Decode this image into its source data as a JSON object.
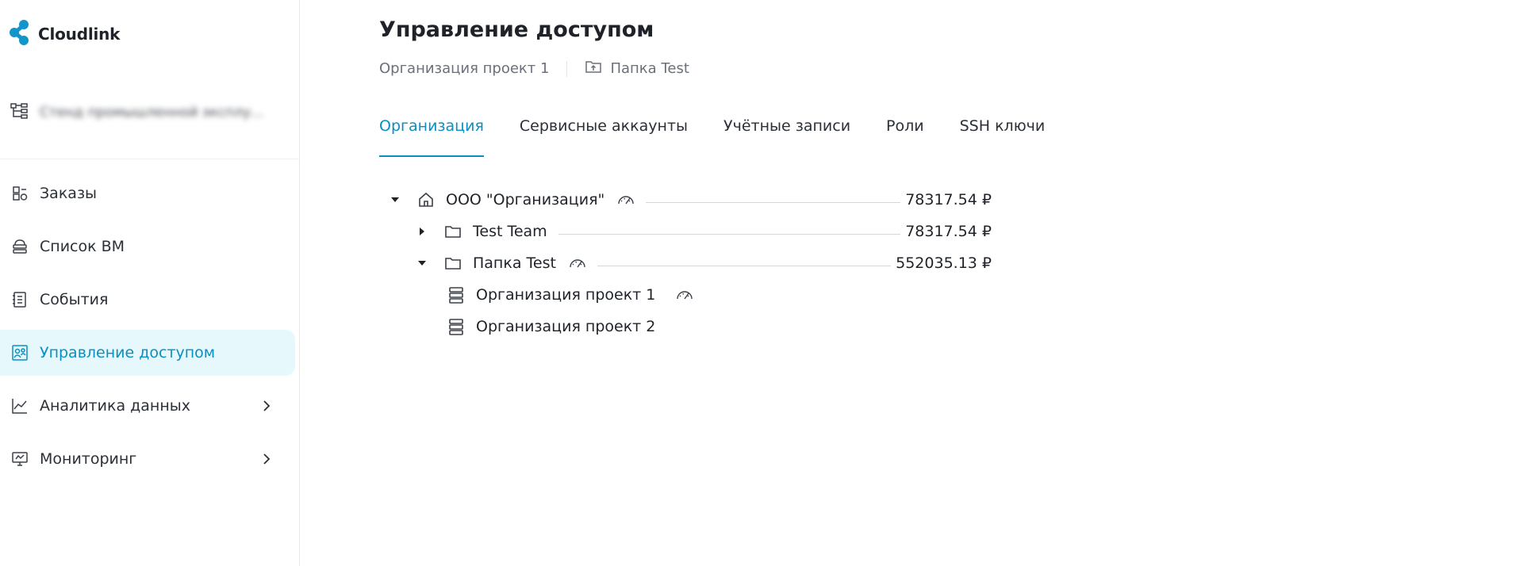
{
  "app": {
    "brand": "Cloudlink",
    "accent": "#0a8fc0",
    "logo_color": "#1296c9"
  },
  "sidebar": {
    "project_switcher": {
      "label": "Стенд промышленной эксплу...",
      "icon": "hierarchy-icon"
    },
    "items": [
      {
        "label": "Заказы",
        "icon": "orders-icon",
        "active": false,
        "has_submenu": false
      },
      {
        "label": "Список ВМ",
        "icon": "vm-list-icon",
        "active": false,
        "has_submenu": false
      },
      {
        "label": "События",
        "icon": "events-icon",
        "active": false,
        "has_submenu": false
      },
      {
        "label": "Управление доступом",
        "icon": "access-icon",
        "active": true,
        "has_submenu": false
      },
      {
        "label": "Аналитика данных",
        "icon": "chart-icon",
        "active": false,
        "has_submenu": true
      },
      {
        "label": "Мониторинг",
        "icon": "monitor-icon",
        "active": false,
        "has_submenu": true
      }
    ]
  },
  "header": {
    "title": "Управление доступом",
    "breadcrumb": {
      "project": "Организация проект 1",
      "folder": "Папка Test"
    }
  },
  "tabs": [
    {
      "label": "Организация",
      "active": true
    },
    {
      "label": "Сервисные аккаунты",
      "active": false
    },
    {
      "label": "Учётные записи",
      "active": false
    },
    {
      "label": "Роли",
      "active": false
    },
    {
      "label": "SSH ключи",
      "active": false
    }
  ],
  "tree": {
    "org": {
      "name": "ООО \"Организация\"",
      "amount": "78317.54 ₽",
      "expanded": true
    },
    "team": {
      "name": "Test Team",
      "amount": "78317.54 ₽",
      "expanded": false
    },
    "folder": {
      "name": "Папка Test",
      "amount": "552035.13 ₽",
      "expanded": true
    },
    "projects": [
      {
        "name": "Организация проект 1",
        "has_meter": true
      },
      {
        "name": "Организация проект 2",
        "has_meter": false
      }
    ]
  }
}
